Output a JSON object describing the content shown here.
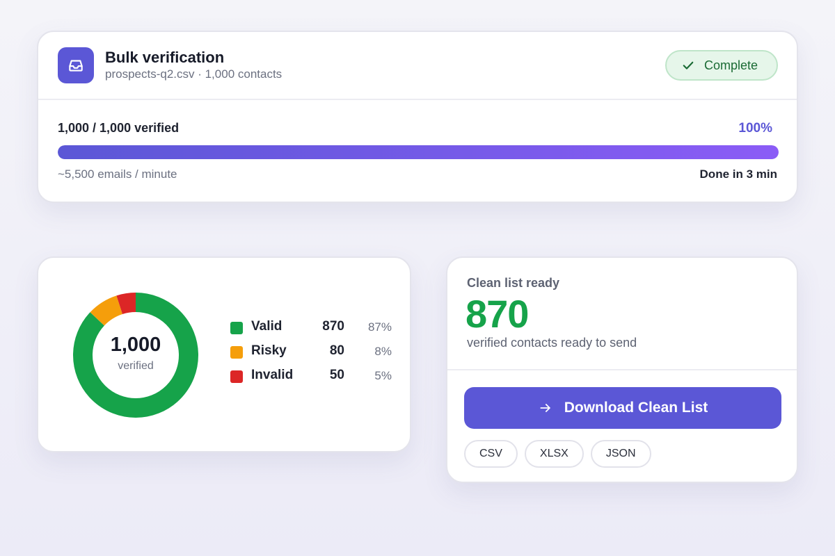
{
  "job": {
    "title": "Bulk verification",
    "subtitle": "prospects-q2.csv · 1,000 contacts",
    "status": "Complete",
    "icon": "inbox-icon"
  },
  "progress": {
    "label": "1,000 / 1,000 verified",
    "percent_text": "100%",
    "fraction": 1.0,
    "rate": "~5,500 emails / minute",
    "eta": "Done in 3 min"
  },
  "breakdown": {
    "total": "1,000",
    "total_label": "verified",
    "items": [
      {
        "label": "Valid",
        "count": "870",
        "percent": "87%",
        "value": 870,
        "color": "#16a34a"
      },
      {
        "label": "Risky",
        "count": "80",
        "percent": "8%",
        "value": 80,
        "color": "#f59e0b"
      },
      {
        "label": "Invalid",
        "count": "50",
        "percent": "5%",
        "value": 50,
        "color": "#dc2626"
      }
    ]
  },
  "clean_list": {
    "heading": "Clean list ready",
    "count": "870",
    "description": "verified contacts ready to send",
    "download_label": "Download Clean List",
    "formats": [
      "CSV",
      "XLSX",
      "JSON"
    ]
  },
  "colors": {
    "accent": "#5b57d6",
    "accent_end": "#8b5cf6",
    "success": "#16a34a",
    "warning": "#f59e0b",
    "danger": "#dc2626"
  }
}
